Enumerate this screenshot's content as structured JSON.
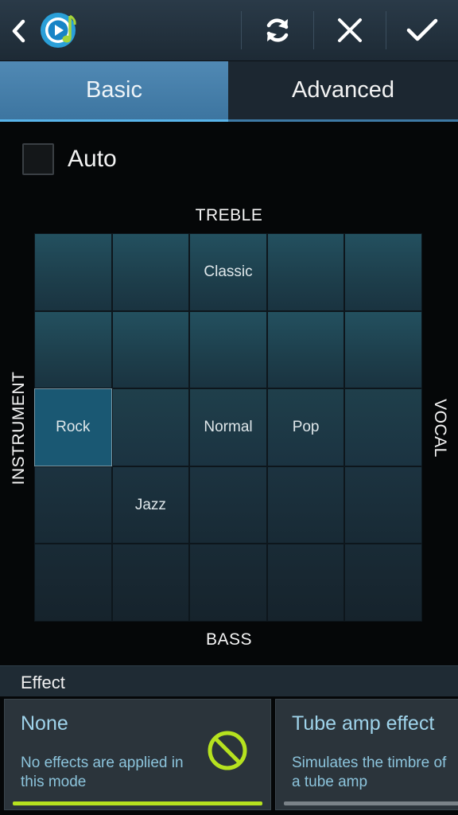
{
  "tabs": {
    "basic": "Basic",
    "advanced": "Advanced"
  },
  "auto": {
    "label": "Auto",
    "checked": false
  },
  "axes": {
    "top": "TREBLE",
    "bottom": "BASS",
    "left": "INSTRUMENT",
    "right": "VOCAL"
  },
  "grid": {
    "rows": [
      [
        "",
        "",
        "Classic",
        "",
        ""
      ],
      [
        "",
        "",
        "",
        "",
        ""
      ],
      [
        "Rock",
        "",
        "Normal",
        "Pop",
        ""
      ],
      [
        "",
        "Jazz",
        "",
        "",
        ""
      ],
      [
        "",
        "",
        "",
        "",
        ""
      ]
    ],
    "selected": "Rock"
  },
  "effect": {
    "title": "Effect",
    "cards": [
      {
        "title": "None",
        "description": "No effects are applied in this mode",
        "selected": true
      },
      {
        "title": "Tube amp effect",
        "description": "Simulates the timbre of a tube amp",
        "selected": false
      }
    ]
  },
  "colors": {
    "accent_green": "#b6e21f",
    "tab_selected": "#4a83ae",
    "card_text": "#9fd3ea"
  }
}
